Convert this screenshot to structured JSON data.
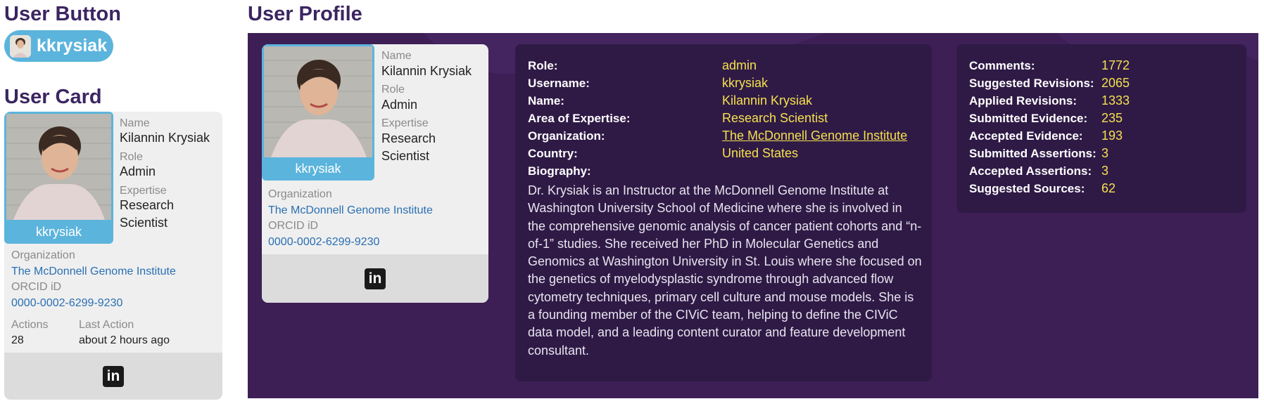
{
  "titles": {
    "user_button": "User Button",
    "user_card": "User Card",
    "user_profile": "User Profile"
  },
  "user": {
    "username": "kkrysiak",
    "name_label": "Name",
    "name": "Kilannin Krysiak",
    "role_label": "Role",
    "role": "Admin",
    "expertise_label": "Expertise",
    "expertise_line1": "Research",
    "expertise_line2": "Scientist",
    "organization_label": "Organization",
    "organization": "The McDonnell Genome Institute",
    "orcid_label": "ORCID iD",
    "orcid": "0000-0002-6299-9230",
    "actions_label": "Actions",
    "actions": "28",
    "last_action_label": "Last Action",
    "last_action": "about 2 hours ago"
  },
  "profile_details": {
    "rows": [
      {
        "label": "Role:",
        "value": "admin"
      },
      {
        "label": "Username:",
        "value": "kkrysiak"
      },
      {
        "label": "Name:",
        "value": "Kilannin Krysiak"
      },
      {
        "label": "Area of Expertise:",
        "value": "Research Scientist"
      },
      {
        "label": "Organization:",
        "value": "The McDonnell Genome Institute"
      },
      {
        "label": "Country:",
        "value": "United States"
      }
    ],
    "biography_label": "Biography:",
    "biography": "Dr. Krysiak is an Instructor at the McDonnell Genome Institute at Washington University School of Medicine where she is involved in the comprehensive genomic analysis of cancer patient cohorts and “n-of-1” studies. She received her PhD in Molecular Genetics and Genomics at Washington University in St. Louis where she focused on the genetics of myelodysplastic syndrome through advanced flow cytometry techniques, primary cell culture and mouse models. She is a founding member of the CIViC team, helping to define the CIViC data model, and a leading content curator and feature development consultant."
  },
  "stats": [
    {
      "label": "Comments:",
      "value": "1772"
    },
    {
      "label": "Suggested Revisions:",
      "value": "2065"
    },
    {
      "label": "Applied Revisions:",
      "value": "1333"
    },
    {
      "label": "Submitted Evidence:",
      "value": "235"
    },
    {
      "label": "Accepted Evidence:",
      "value": "193"
    },
    {
      "label": "Submitted Assertions:",
      "value": "3"
    },
    {
      "label": "Accepted Assertions:",
      "value": "3"
    },
    {
      "label": "Suggested Sources:",
      "value": "62"
    }
  ],
  "icons": {
    "linkedin": "linkedin-icon",
    "avatar": "user-photo"
  },
  "colors": {
    "title": "#3b2561",
    "accent_blue": "#5bb4dc",
    "profile_bg": "#3d1f56",
    "value_yellow": "#f4e04d",
    "link_blue": "#2a6fb3"
  },
  "linkedin_glyph": "in"
}
